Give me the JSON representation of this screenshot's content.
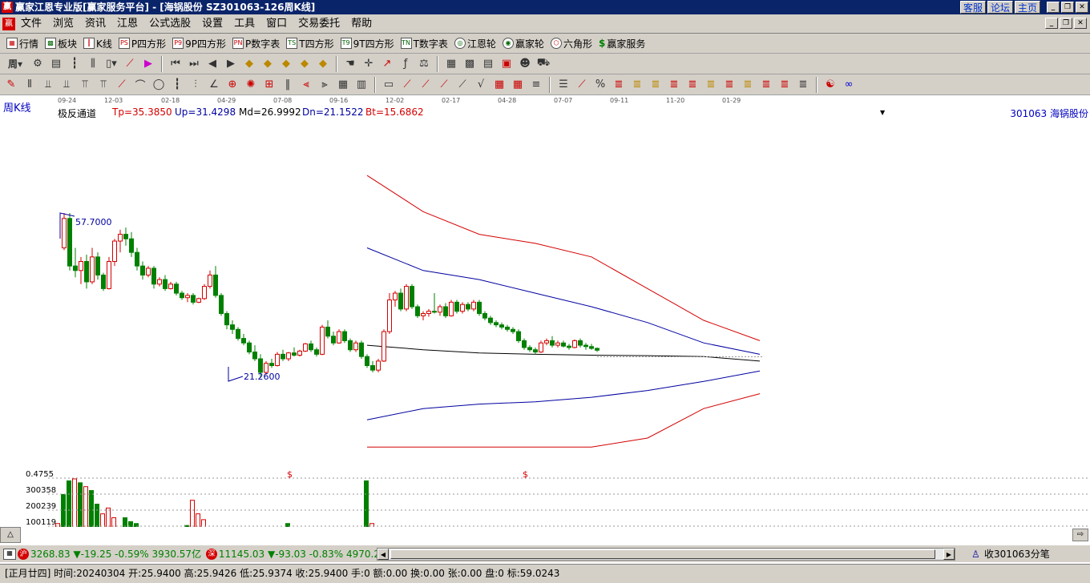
{
  "titlebar": {
    "text": "赢家江恩专业版[赢家服务平台] - [海锅股份  SZ301063-126周K线]",
    "links": [
      "客服",
      "论坛",
      "主页"
    ]
  },
  "menu": [
    "文件",
    "浏览",
    "资讯",
    "江恩",
    "公式选股",
    "设置",
    "工具",
    "窗口",
    "交易委托",
    "帮助"
  ],
  "toolbar1": [
    {
      "label": "行情",
      "icon": "grid-icon"
    },
    {
      "label": "板块",
      "icon": "blocks-icon"
    },
    {
      "label": "K线",
      "icon": "candles-icon"
    },
    {
      "label": "P四方形",
      "icon": "ps-icon"
    },
    {
      "label": "9P四方形",
      "icon": "p9-icon"
    },
    {
      "label": "P数字表",
      "icon": "pn-icon"
    },
    {
      "label": "T四方形",
      "icon": "ts-icon"
    },
    {
      "label": "9T四方形",
      "icon": "t9-icon"
    },
    {
      "label": "T数字表",
      "icon": "tn-icon"
    },
    {
      "label": "江恩轮",
      "icon": "gann-wheel-icon"
    },
    {
      "label": "赢家轮",
      "icon": "winner-wheel-icon"
    },
    {
      "label": "六角形",
      "icon": "hexagon-icon"
    },
    {
      "label": "赢家服务",
      "icon": "dollar-icon"
    }
  ],
  "period": "周",
  "time_axis": [
    "09-24",
    "12-03",
    "02-18",
    "04-29",
    "07-08",
    "09-16",
    "12-02",
    "02-17",
    "04-28",
    "07-07",
    "09-11",
    "11-20",
    "01-29"
  ],
  "info": {
    "period_label": "周K线",
    "indicator": "极反通道",
    "tp": "Tp=35.3850",
    "up": "Up=31.4298",
    "md": "Md=26.9992",
    "dn": "Dn=21.1522",
    "bt": "Bt=15.6862",
    "stock": "301063  海锅股份"
  },
  "annotations": {
    "high": "57.7000",
    "low": "21.2600",
    "dollar": "$"
  },
  "volume_axis": [
    "0.4755",
    "300358",
    "200239",
    "100119"
  ],
  "status1": {
    "sh_badge": "沪",
    "sh_index": "3268.83",
    "sh_change": "▼-19.25 -0.59% 3930.57亿",
    "sz_badge": "深",
    "sz_index": "11145.03",
    "sz_change": "▼-93.03 -0.83% 4970.2",
    "right": "收301063分笔"
  },
  "status2": "[正月廿四] 时间:20240304 开:25.9400 高:25.9426 低:25.9374 收:25.9400 手:0 额:0.00 换:0.00 张:0.00 盘:0 标:59.0243",
  "colors": {
    "up": "#d40000",
    "down": "#008000",
    "channel_outer": "#d40000",
    "channel_inner": "#0000a0",
    "mid": "#000000"
  },
  "chart_data": {
    "type": "candlestick",
    "ohlc": [
      [
        50.0,
        57.7,
        49.5,
        56.5
      ],
      [
        56.5,
        57.7,
        45.0,
        46.0
      ],
      [
        46.0,
        50.0,
        43.5,
        45.0
      ],
      [
        45.0,
        48.0,
        42.0,
        47.0
      ],
      [
        47.0,
        48.5,
        41.0,
        42.5
      ],
      [
        42.5,
        50.0,
        42.0,
        48.0
      ],
      [
        48.0,
        49.0,
        43.0,
        44.0
      ],
      [
        44.0,
        44.5,
        40.5,
        41.0
      ],
      [
        41.0,
        48.0,
        40.8,
        47.0
      ],
      [
        47.0,
        52.0,
        46.0,
        51.5
      ],
      [
        51.5,
        54.0,
        49.0,
        53.0
      ],
      [
        53.0,
        54.5,
        50.5,
        52.0
      ],
      [
        52.0,
        53.5,
        48.0,
        49.0
      ],
      [
        49.0,
        50.0,
        45.0,
        46.0
      ],
      [
        46.0,
        47.0,
        43.0,
        44.0
      ],
      [
        44.0,
        46.0,
        43.5,
        45.5
      ],
      [
        45.5,
        46.0,
        41.0,
        42.0
      ],
      [
        42.0,
        43.5,
        41.5,
        43.0
      ],
      [
        43.0,
        44.0,
        40.5,
        41.0
      ],
      [
        41.0,
        42.5,
        40.8,
        42.0
      ],
      [
        42.0,
        42.5,
        39.5,
        40.0
      ],
      [
        40.0,
        40.5,
        38.5,
        39.0
      ],
      [
        39.0,
        40.0,
        38.0,
        39.5
      ],
      [
        39.5,
        40.0,
        37.5,
        38.0
      ],
      [
        38.0,
        39.0,
        37.8,
        38.8
      ],
      [
        38.8,
        42.0,
        38.5,
        41.5
      ],
      [
        41.5,
        45.0,
        41.0,
        44.0
      ],
      [
        44.0,
        46.0,
        39.0,
        39.5
      ],
      [
        39.5,
        40.0,
        35.0,
        35.5
      ],
      [
        35.5,
        36.0,
        32.0,
        33.0
      ],
      [
        33.0,
        34.0,
        31.0,
        32.0
      ],
      [
        32.0,
        32.5,
        29.5,
        30.0
      ],
      [
        30.0,
        31.0,
        28.5,
        29.0
      ],
      [
        29.0,
        29.5,
        26.5,
        27.0
      ],
      [
        27.0,
        28.5,
        25.0,
        25.5
      ],
      [
        25.5,
        26.5,
        21.26,
        22.5
      ],
      [
        22.5,
        25.0,
        22.0,
        24.5
      ],
      [
        24.5,
        25.5,
        23.5,
        24.0
      ],
      [
        24.0,
        27.0,
        23.8,
        26.5
      ],
      [
        26.5,
        27.5,
        25.0,
        25.5
      ],
      [
        25.5,
        27.0,
        25.0,
        26.8
      ],
      [
        26.8,
        28.0,
        26.0,
        26.3
      ],
      [
        26.3,
        27.5,
        26.0,
        27.2
      ],
      [
        27.2,
        29.0,
        27.0,
        28.8
      ],
      [
        28.8,
        29.5,
        27.0,
        27.5
      ],
      [
        27.5,
        28.0,
        26.0,
        26.5
      ],
      [
        26.5,
        33.0,
        26.3,
        32.5
      ],
      [
        32.5,
        34.0,
        30.0,
        30.5
      ],
      [
        30.5,
        31.5,
        28.5,
        29.0
      ],
      [
        29.0,
        32.0,
        28.8,
        31.5
      ],
      [
        31.5,
        32.0,
        29.0,
        29.5
      ],
      [
        29.5,
        30.0,
        27.0,
        27.5
      ],
      [
        27.5,
        29.5,
        27.0,
        29.0
      ],
      [
        29.0,
        29.5,
        25.5,
        26.0
      ],
      [
        26.0,
        26.5,
        23.5,
        24.0
      ],
      [
        24.0,
        25.0,
        22.5,
        23.0
      ],
      [
        23.0,
        25.5,
        22.5,
        25.0
      ],
      [
        25.0,
        32.0,
        24.8,
        31.5
      ],
      [
        31.5,
        40.0,
        31.0,
        38.5
      ],
      [
        38.5,
        40.5,
        37.0,
        40.0
      ],
      [
        40.0,
        41.0,
        36.0,
        36.5
      ],
      [
        36.5,
        42.0,
        36.0,
        41.5
      ],
      [
        41.5,
        42.0,
        36.5,
        37.0
      ],
      [
        37.0,
        37.5,
        34.5,
        35.0
      ],
      [
        35.0,
        36.0,
        34.0,
        35.5
      ],
      [
        35.5,
        36.5,
        34.8,
        36.0
      ],
      [
        36.0,
        40.0,
        35.5,
        35.8
      ],
      [
        35.8,
        37.5,
        35.0,
        37.0
      ],
      [
        37.0,
        37.8,
        34.5,
        35.0
      ],
      [
        35.0,
        38.5,
        34.8,
        38.0
      ],
      [
        38.0,
        38.5,
        35.5,
        36.0
      ],
      [
        36.0,
        38.0,
        35.5,
        37.5
      ],
      [
        37.5,
        38.0,
        36.0,
        36.5
      ],
      [
        36.5,
        38.5,
        36.0,
        38.0
      ],
      [
        38.0,
        38.5,
        35.0,
        35.5
      ],
      [
        35.5,
        36.0,
        34.0,
        34.5
      ],
      [
        34.5,
        35.0,
        33.0,
        33.5
      ],
      [
        33.5,
        34.0,
        32.5,
        33.0
      ],
      [
        33.0,
        33.5,
        32.0,
        32.5
      ],
      [
        32.5,
        33.0,
        31.5,
        32.0
      ],
      [
        32.0,
        32.5,
        31.0,
        31.5
      ],
      [
        31.5,
        32.0,
        29.0,
        29.5
      ],
      [
        29.5,
        30.0,
        27.5,
        28.0
      ],
      [
        28.0,
        28.5,
        27.0,
        27.5
      ],
      [
        27.5,
        28.0,
        26.5,
        27.0
      ],
      [
        27.0,
        29.5,
        26.8,
        29.0
      ],
      [
        29.0,
        30.0,
        28.5,
        29.5
      ],
      [
        29.5,
        30.5,
        28.0,
        28.5
      ],
      [
        28.5,
        29.5,
        28.0,
        29.0
      ],
      [
        29.0,
        29.5,
        28.0,
        28.3
      ],
      [
        28.3,
        28.8,
        27.5,
        28.0
      ],
      [
        28.0,
        29.8,
        27.8,
        29.5
      ],
      [
        29.5,
        30.0,
        28.0,
        28.5
      ],
      [
        28.5,
        29.0,
        27.5,
        28.2
      ],
      [
        28.2,
        28.8,
        27.5,
        27.8
      ],
      [
        27.8,
        28.0,
        27.0,
        27.4
      ]
    ],
    "volume": [
      100000,
      250000,
      320000,
      330000,
      310000,
      290000,
      270000,
      200000,
      150000,
      180000,
      130000,
      80000,
      130000,
      110000,
      100000,
      40000,
      30000,
      40000,
      35000,
      30000,
      40000,
      35000,
      25000,
      90000,
      220000,
      150000,
      120000,
      80000,
      60000,
      40000,
      35000,
      60000,
      70000,
      80000,
      55000,
      50000,
      25000,
      30000,
      35000,
      50000,
      70000,
      100000,
      60000,
      50000,
      45000,
      60000,
      80000,
      50000,
      40000,
      30000,
      35000,
      30000,
      25000,
      25000,
      30000,
      320000,
      100000,
      80000,
      60000,
      50000,
      30000,
      40000,
      80000,
      50000,
      60000,
      40000,
      60000,
      40000,
      30000,
      25000,
      30000,
      40000,
      20000,
      30000,
      50000,
      30000,
      25000,
      40000,
      30000,
      25000,
      20000,
      25000,
      20000,
      15000,
      20000,
      25000,
      15000,
      15000,
      10000,
      5000
    ],
    "channel": {
      "x": [
        0.0,
        10,
        20,
        30,
        40,
        50,
        60,
        70
      ],
      "tp": [
        66.0,
        58.0,
        53.0,
        51.0,
        48.0,
        41.0,
        34.0,
        29.5
      ],
      "up": [
        50.0,
        45.0,
        43.0,
        40.0,
        37.0,
        33.5,
        29.0,
        26.5
      ],
      "md": [
        28.5,
        27.5,
        26.8,
        26.5,
        26.3,
        26.2,
        26.0,
        25.0
      ],
      "dn": [
        12.0,
        14.5,
        15.5,
        16.0,
        17.0,
        18.5,
        20.5,
        22.8
      ],
      "bt": [
        6.0,
        6.0,
        6.0,
        6.0,
        6.0,
        8.0,
        14.5,
        17.8
      ]
    },
    "last_close": 25.94,
    "price_high": 57.7,
    "price_low": 21.26
  }
}
